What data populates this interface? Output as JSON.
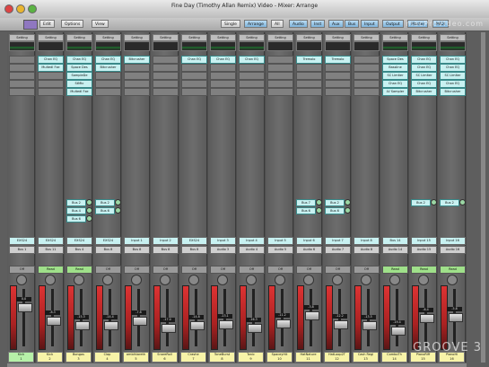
{
  "window": {
    "title": "Fine Day (Timothy Allan Remix) Video - Mixer: Arrange"
  },
  "toolbar": {
    "menus": [
      "Edit",
      "Options",
      "View"
    ],
    "tabs": [
      "Single",
      "Arrange",
      "All"
    ],
    "filters": [
      "Audio",
      "Inst",
      "Aux",
      "Bus",
      "Input",
      "Output",
      "Master",
      "MIDI"
    ],
    "active_tabs": [
      "Arrange"
    ]
  },
  "watermark": "macProVideo.com",
  "brand": "GROOVE 3",
  "strips": [
    {
      "setting": "Setting",
      "eq": true,
      "inserts": [],
      "sends": [],
      "input": "EXS24",
      "output": "Bus 1",
      "vol": "0.0",
      "name": "Kick",
      "num": "1",
      "auto": "Off",
      "fader": 0.72
    },
    {
      "setting": "Setting",
      "eq": false,
      "inserts": [
        "Chan EQ",
        "Multedl Fxe"
      ],
      "sends": [],
      "input": "EXS24",
      "output": "Bus 11",
      "vol": "-8.3",
      "name": "Kick",
      "num": "2",
      "auto": "Read",
      "fader": 0.45
    },
    {
      "setting": "Setting",
      "eq": true,
      "inserts": [
        "Chan EQ",
        "Space Des",
        "SampleDe",
        "StMtc",
        "Multedl Fxe"
      ],
      "sends": [
        "Bus 2",
        "Bus 4",
        "Bus 6"
      ],
      "input": "EXS24",
      "output": "Bus 4",
      "vol": "-15.3",
      "name": "Bongos",
      "num": "3",
      "auto": "Read",
      "fader": 0.35
    },
    {
      "setting": "Setting",
      "eq": true,
      "inserts": [
        "Chan EQ",
        "Bitcrusher"
      ],
      "sends": [
        "Bus 2",
        "Bus 6"
      ],
      "input": "EXS24",
      "output": "Bus 8",
      "vol": "-14.4",
      "name": "Clap",
      "num": "4",
      "auto": "Off",
      "fader": 0.35
    },
    {
      "setting": "Setting",
      "eq": false,
      "inserts": [
        "Bitcrusher"
      ],
      "sends": [],
      "input": "Input 1",
      "output": "Bus 8",
      "vol": "-7.8",
      "name": "ambihiareth",
      "num": "5",
      "auto": "Off",
      "fader": 0.45
    },
    {
      "setting": "Setting",
      "eq": false,
      "inserts": [],
      "sends": [],
      "input": "Input 2",
      "output": "Bus 8",
      "vol": "-17.0",
      "name": "SnareRoll",
      "num": "6",
      "auto": "Off",
      "fader": 0.3
    },
    {
      "setting": "Setting",
      "eq": true,
      "inserts": [
        "Chan EQ"
      ],
      "sends": [],
      "input": "EXS24",
      "output": "Bus 8",
      "vol": "-14.8",
      "name": "Crashe",
      "num": "7",
      "auto": "Off",
      "fader": 0.35
    },
    {
      "setting": "Setting",
      "eq": true,
      "inserts": [
        "Chan EQ"
      ],
      "sends": [],
      "input": "Input 3",
      "output": "Audio 3",
      "vol": "-13.1",
      "name": "ToneBurst",
      "num": "8",
      "auto": "Off",
      "fader": 0.38
    },
    {
      "setting": "Setting",
      "eq": true,
      "inserts": [
        "Chan EQ"
      ],
      "sends": [],
      "input": "Input 4",
      "output": "Audio 4",
      "vol": "-16.3",
      "name": "Tonic",
      "num": "9",
      "auto": "Off",
      "fader": 0.3
    },
    {
      "setting": "Setting",
      "eq": false,
      "inserts": [],
      "sends": [],
      "input": "Input 5",
      "output": "Audio 5",
      "vol": "-11.2",
      "name": "SpaceyHit",
      "num": "10",
      "auto": "Off",
      "fader": 0.4
    },
    {
      "setting": "Setting",
      "eq": false,
      "inserts": [
        "Tremolo"
      ],
      "sends": [
        "Bus 7",
        "Bus 6"
      ],
      "input": "Input 6",
      "output": "Audio 6",
      "vol": "-3.8",
      "name": "HatNature",
      "num": "11",
      "auto": "Off",
      "fader": 0.55
    },
    {
      "setting": "Setting",
      "eq": false,
      "inserts": [
        "Tremolo"
      ],
      "sends": [
        "Bus 2",
        "Bus 6"
      ],
      "input": "Input 7",
      "output": "Audio 7",
      "vol": "-12.2",
      "name": "HatLoop2T",
      "num": "12",
      "auto": "Off",
      "fader": 0.38
    },
    {
      "setting": "Setting",
      "eq": false,
      "inserts": [],
      "sends": [],
      "input": "Input 8",
      "output": "Audio 8",
      "vol": "-13.5",
      "name": "Cash Regi",
      "num": "13",
      "auto": "Off",
      "fader": 0.35
    },
    {
      "setting": "Setting",
      "eq": true,
      "inserts": [
        "Space Des",
        "Bassline",
        "SC Limiter",
        "Chan EQ",
        "LV Sampler"
      ],
      "sends": [],
      "input": "Bus 14",
      "output": "Audio 14",
      "vol": "-19.4",
      "name": "ComboTh",
      "num": "14",
      "auto": "Read",
      "fader": 0.25
    },
    {
      "setting": "Setting",
      "eq": true,
      "inserts": [
        "Chan EQ",
        "Chan EQ",
        "SC Limiter",
        "Chan EQ",
        "Bitcrusher"
      ],
      "sends": [
        "Bus 2"
      ],
      "input": "Input 15",
      "output": "Audio 15",
      "vol": "-6.4",
      "name": "PianoRiff",
      "num": "15",
      "auto": "Read",
      "fader": 0.5
    },
    {
      "setting": "Setting",
      "eq": true,
      "inserts": [
        "Chan EQ",
        "Chan EQ",
        "SC Limiter",
        "Chan EQ",
        "Bitcrusher"
      ],
      "sends": [
        "Bus 2"
      ],
      "input": "Input 16",
      "output": "Audio 16",
      "vol": "-5.8",
      "name": "PianoHi",
      "num": "16",
      "auto": "Read",
      "fader": 0.52
    }
  ]
}
